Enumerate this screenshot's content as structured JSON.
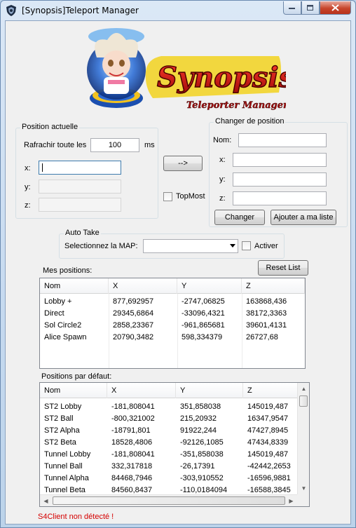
{
  "window": {
    "title": "[Synopsis]Teleport Manager",
    "minimize_icon": "minimize-icon",
    "maximize_icon": "maximize-icon",
    "close_icon": "close-icon"
  },
  "logo": {
    "brand": "Synopsis",
    "subtitle": "Teleporter Manager",
    "colors": {
      "brand_red": "#d11a1a",
      "brand_yellow": "#f2d21f",
      "orb_blue": "#2f6fd6"
    }
  },
  "position_actuelle": {
    "group_label": "Position actuelle",
    "refresh_label": "Rafrachir toute les",
    "refresh_value": "100",
    "refresh_unit": "ms",
    "x_label": "x:",
    "y_label": "y:",
    "z_label": "z:",
    "x_value": "",
    "y_value": "",
    "z_value": ""
  },
  "copy_button_label": "-->",
  "topmost": {
    "label": "TopMost",
    "checked": false
  },
  "changer_position": {
    "group_label": "Changer de position",
    "nom_label": "Nom:",
    "x_label": "x:",
    "y_label": "y:",
    "z_label": "z:",
    "nom_value": "",
    "x_value": "",
    "y_value": "",
    "z_value": "",
    "changer_button": "Changer",
    "ajouter_button": "Ajouter a ma liste"
  },
  "auto_take": {
    "group_label": "Auto Take",
    "select_label": "Selectionnez la MAP:",
    "selected_map": "",
    "activer_label": "Activer",
    "activer_checked": false
  },
  "mes_positions": {
    "label": "Mes positions:",
    "reset_button": "Reset List",
    "columns": [
      "Nom",
      "X",
      "Y",
      "Z"
    ],
    "rows": [
      [
        "Lobby +",
        "877,692957",
        "-2747,06825",
        "163868,436"
      ],
      [
        "Direct",
        "29345,6864",
        "-33096,4321",
        "38172,3363"
      ],
      [
        "Sol Circle2",
        "2858,23367",
        "-961,865681",
        "39601,4131"
      ],
      [
        "Alice Spawn",
        "20790,3482",
        "598,334379",
        "26727,68"
      ]
    ]
  },
  "positions_defaut": {
    "label": "Positions par défaut:",
    "columns": [
      "Nom",
      "X",
      "Y",
      "Z"
    ],
    "rows": [
      [
        "ST2 Lobby",
        "-181,808041",
        "351,858038",
        "145019,487"
      ],
      [
        "ST2 Ball",
        "-800,321002",
        "215,20932",
        "16347,9547"
      ],
      [
        "ST2 Alpha",
        "-18791,801",
        "91922,244",
        "47427,8945"
      ],
      [
        "ST2 Beta",
        "18528,4806",
        "-92126,1085",
        "47434,8339"
      ],
      [
        "Tunnel Lobby",
        "-181,808041",
        "-351,858038",
        "145019,487"
      ],
      [
        "Tunnel Ball",
        "332,317818",
        "-26,17391",
        "-42442,2653"
      ],
      [
        "Tunnel Alpha",
        "84468,7946",
        "-303,910552",
        "-16596,9881"
      ],
      [
        "Tunnel Beta",
        "84560,8437",
        "-110,0184094",
        "-16588,3845"
      ]
    ]
  },
  "status_text": "S4Client non détecté !"
}
